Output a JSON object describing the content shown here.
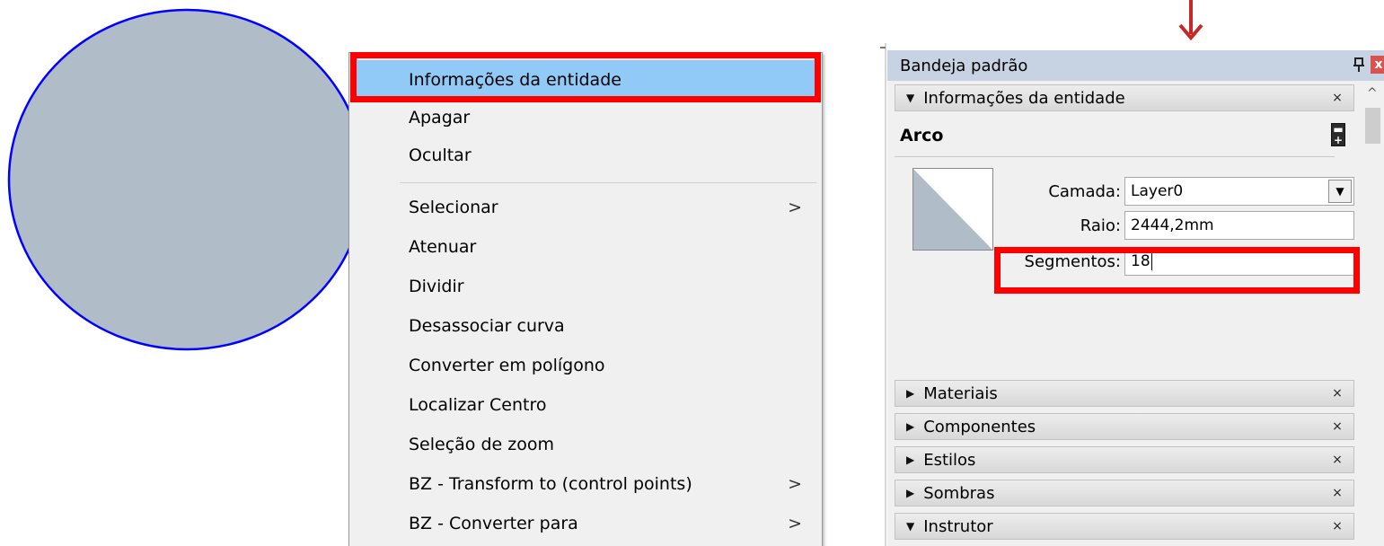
{
  "context_menu": {
    "items": [
      {
        "label": "Informações da entidade",
        "highlighted": true,
        "submenu": false
      },
      {
        "label": "Apagar",
        "submenu": false
      },
      {
        "label": "Ocultar",
        "submenu": false
      },
      {
        "label": "Selecionar",
        "submenu": true
      },
      {
        "label": "Atenuar",
        "submenu": false
      },
      {
        "label": "Dividir",
        "submenu": false
      },
      {
        "label": "Desassociar curva",
        "submenu": false
      },
      {
        "label": "Converter em polígono",
        "submenu": false
      },
      {
        "label": "Localizar Centro",
        "submenu": false
      },
      {
        "label": "Seleção de zoom",
        "submenu": false
      },
      {
        "label": "BZ - Transform to (control points)",
        "submenu": true
      },
      {
        "label": "BZ - Converter para",
        "submenu": true
      }
    ],
    "chevron": ">"
  },
  "tray": {
    "title": "Bandeja padrão",
    "pin_glyph": "ᵖ",
    "close_glyph": "x",
    "entity_info": {
      "header": "Informações da entidade",
      "entity_type": "Arco",
      "layer_label": "Camada:",
      "layer_value": "Layer0",
      "radius_label": "Raio:",
      "radius_value": "2444,2mm",
      "segments_label": "Segmentos:",
      "segments_value": "18"
    },
    "sections": [
      {
        "label": "Materiais",
        "expanded": false
      },
      {
        "label": "Componentes",
        "expanded": false
      },
      {
        "label": "Estilos",
        "expanded": false
      },
      {
        "label": "Sombras",
        "expanded": false
      },
      {
        "label": "Instrutor",
        "expanded": true
      }
    ],
    "section_close_glyph": "×"
  },
  "colors": {
    "highlight_box": "#ff0000",
    "menu_highlight": "#91c9f7",
    "circle_fill": "#b0bcc8",
    "circle_edge": "#0000ff",
    "arrow": "#c62828"
  }
}
